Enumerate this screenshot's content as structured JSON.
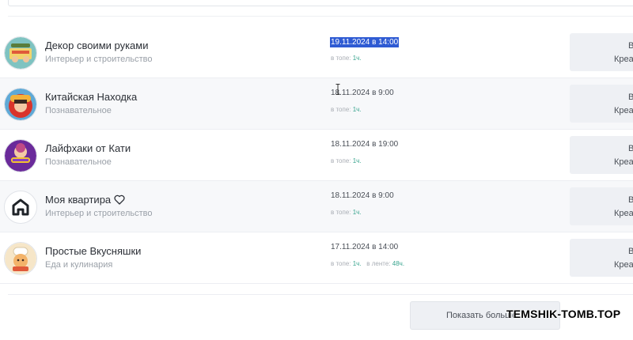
{
  "rows": [
    {
      "name": "Декор своими руками",
      "category": "Интерьер и строительство",
      "date": "19.11.2024 в 14:00",
      "stats_label": "в топе:",
      "stats_value": "1ч.",
      "feed_label": "",
      "feed_value": "",
      "button_top": "В",
      "button_bottom": "Креа",
      "avatar_icon": "craft-hands-icon"
    },
    {
      "name": "Китайская Находка",
      "category": "Познавательное",
      "date": "18.11.2024 в 9:00",
      "stats_label": "в топе:",
      "stats_value": "1ч.",
      "feed_label": "",
      "feed_value": "",
      "button_top": "В",
      "button_bottom": "Креа",
      "avatar_icon": "chinese-girl-icon"
    },
    {
      "name": "Лайфхаки от Кати",
      "category": "Познавательное",
      "date": "18.11.2024 в 19:00",
      "stats_label": "в топе:",
      "stats_value": "1ч.",
      "feed_label": "",
      "feed_value": "",
      "button_top": "В",
      "button_bottom": "Креа",
      "avatar_icon": "lifehack-icon"
    },
    {
      "name": "Моя квартира",
      "category": "Интерьер и строительство",
      "date": "18.11.2024 в 9:00",
      "stats_label": "в топе:",
      "stats_value": "1ч.",
      "feed_label": "",
      "feed_value": "",
      "button_top": "В",
      "button_bottom": "Креа",
      "avatar_icon": "house-icon"
    },
    {
      "name": "Простые Вкусняшки",
      "category": "Еда и кулинария",
      "date": "17.11.2024 в 14:00",
      "stats_label": "в топе:",
      "stats_value": "1ч.",
      "feed_label": "в ленте:",
      "feed_value": "48ч.",
      "button_top": "В",
      "button_bottom": "Креа",
      "avatar_icon": "chef-icon"
    }
  ],
  "show_more": "Показать больше",
  "watermark": "TEMSHIK-TOMB.TOP",
  "colors": {
    "accent_selection": "#2f5bd3",
    "stats_value": "#3aa58f",
    "button_bg": "#eef0f4"
  }
}
